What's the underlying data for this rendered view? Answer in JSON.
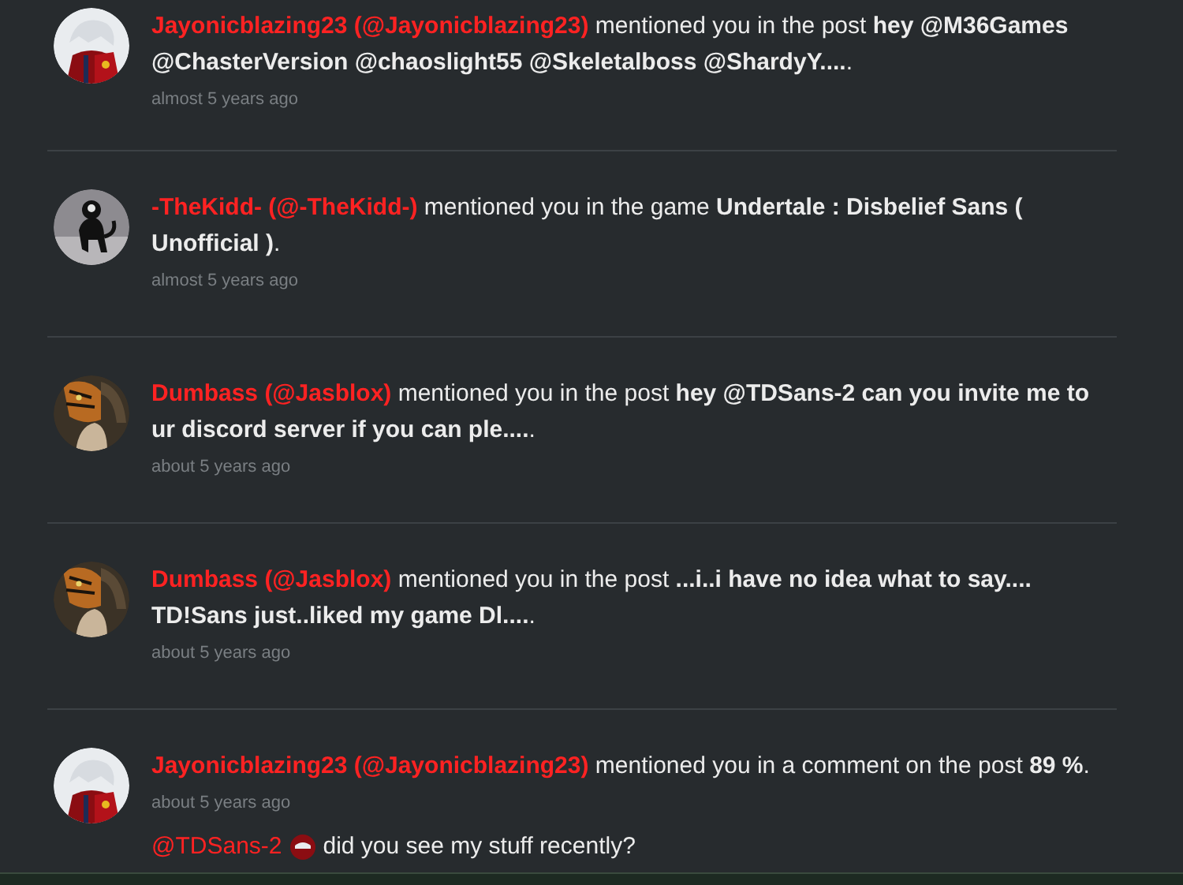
{
  "notifications": [
    {
      "author": "Jayonicblazing23 (@Jayonicblazing23)",
      "message": " mentioned you in the post **hey @M36Games @ChasterVersion @chaoslight55 @Skeletalboss @ShardyY....**.",
      "time": "almost 5 years ago"
    },
    {
      "author": "-TheKidd- (@-TheKidd-)",
      "message": " mentioned you in the game **Undertale : Disbelief Sans ( Unofficial )**.",
      "time": "almost 5 years ago"
    },
    {
      "author": "Dumbass (@Jasblox)",
      "message": " mentioned you in the post **hey @TDSans-2 can you invite me to ur discord server if you can ple....**.",
      "time": "about 5 years ago"
    },
    {
      "author": "Dumbass (@Jasblox)",
      "message": " mentioned you in the post **...i..i have no idea what to say.... TD!Sans just..liked my game Dl....**.",
      "time": "about 5 years ago"
    },
    {
      "author": "Jayonicblazing23 (@Jayonicblazing23)",
      "message": " mentioned you in a comment on the post **89 %**.",
      "time": "about 5 years ago"
    }
  ],
  "reply": {
    "mention": "@TDSans-2",
    "text": "did you see my stuff recently?"
  }
}
